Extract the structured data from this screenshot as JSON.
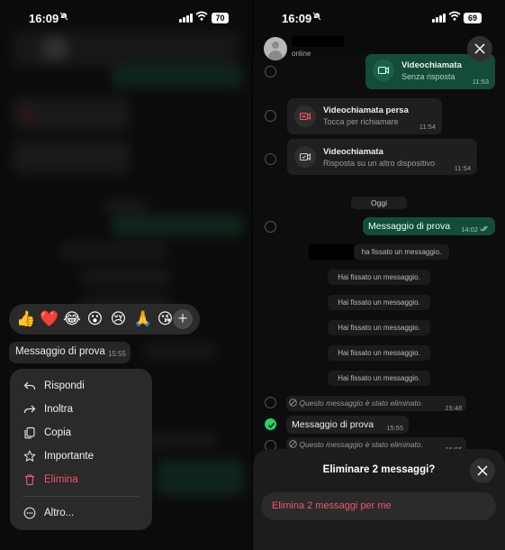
{
  "left_screen": {
    "status": {
      "time": "16:09",
      "battery": "70"
    },
    "reactions": [
      "👍",
      "❤️",
      "😂",
      "😮",
      "😢",
      "🙏",
      "😘"
    ],
    "preview": {
      "text": "Messaggio di prova",
      "time": "15:55"
    },
    "menu": {
      "reply": "Rispondi",
      "forward": "Inoltra",
      "copy": "Copia",
      "star": "Importante",
      "delete": "Elimina",
      "more": "Altro..."
    },
    "colors": {
      "danger": "#f0566d",
      "menu_bg": "#2a2a2a"
    }
  },
  "right_screen": {
    "status": {
      "time": "16:09",
      "battery": "69"
    },
    "header": {
      "contact_status": "online"
    },
    "messages": {
      "video_out": {
        "title": "Videochiamata",
        "subtitle": "Senza risposta",
        "time": "11:53"
      },
      "missed": {
        "title": "Videochiamata persa",
        "subtitle": "Tocca per richiamare",
        "time": "11:54"
      },
      "answered_elsewhere": {
        "title": "Videochiamata",
        "subtitle": "Risposta su un altro dispositivo",
        "time": "11:54"
      },
      "date_divider": "Oggi",
      "test_out": {
        "text": "Messaggio di prova",
        "time": "14:02"
      },
      "pin_named": "ha fissato un messaggio.",
      "pins": [
        "Hai fissato un messaggio.",
        "Hai fissato un messaggio.",
        "Hai fissato un messaggio.",
        "Hai fissato un messaggio.",
        "Hai fissato un messaggio."
      ],
      "deleted_1": {
        "text": "Questo messaggio è stato eliminato.",
        "time": "15:48"
      },
      "test_in": {
        "text": "Messaggio di prova",
        "time": "15:55"
      },
      "deleted_2": {
        "text": "Questo messaggio è stato eliminato.",
        "time": "15:55"
      }
    },
    "sheet": {
      "title": "Eliminare 2 messaggi?",
      "action": "Elimina 2 messaggi per me"
    },
    "colors": {
      "accent": "#25d366",
      "outgoing_bubble": "#144d37",
      "danger": "#f0566d"
    }
  }
}
